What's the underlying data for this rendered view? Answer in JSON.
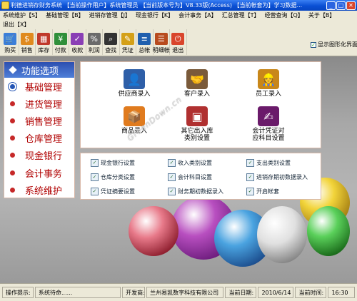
{
  "window": {
    "title": "利德进销存财务系统  【当前操作用户】系统管理员  【当前版本号为】V8.33版(Access)  【当前帐套为】学习数据..."
  },
  "menu": {
    "row1": [
      "系统维护【S】",
      "基础管理【B】",
      "进销存管理【J】",
      "现金银行【K】",
      "会计事务【A】",
      "汇总管理【T】",
      "经营查询【Q】",
      "关于【B】"
    ],
    "row2": [
      "退出【X】"
    ]
  },
  "toolbar": {
    "buttons": [
      {
        "label": "购买",
        "icon": "cart-icon",
        "color": "#3c7fd8"
      },
      {
        "label": "销售",
        "icon": "sale-icon",
        "color": "#e08a1e"
      },
      {
        "label": "库存",
        "icon": "warehouse-icon",
        "color": "#c0392b"
      },
      {
        "label": "付款",
        "icon": "payment-icon",
        "color": "#2f8f3a"
      },
      {
        "label": "收款",
        "icon": "receive-icon",
        "color": "#8a3fb5"
      },
      {
        "label": "利润",
        "icon": "profit-icon",
        "color": "#6b6b6b"
      },
      {
        "label": "查找",
        "icon": "binoculars-icon",
        "color": "#333333"
      },
      {
        "label": "凭证",
        "icon": "voucher-icon",
        "color": "#d4a017"
      },
      {
        "label": "总帐",
        "icon": "ledger-icon",
        "color": "#1f5fae"
      },
      {
        "label": "明细帐",
        "icon": "detail-ledger-icon",
        "color": "#b84b1e"
      },
      {
        "label": "退出",
        "icon": "exit-icon",
        "color": "#d9452c"
      }
    ],
    "show_graphic_label": "显示图形化界面",
    "show_graphic_checked": true
  },
  "sidebar": {
    "header": "功能选项",
    "items": [
      "基础管理",
      "进货管理",
      "销售管理",
      "仓库管理",
      "现金银行",
      "会计事务",
      "系统维护"
    ]
  },
  "panel": {
    "items": [
      {
        "label": "供应商录入",
        "icon": "supplier-person-icon",
        "color": "#2e5fa8"
      },
      {
        "label": "客户录入",
        "icon": "handshake-icon",
        "color": "#7a5a3a"
      },
      {
        "label": "员工录入",
        "icon": "employee-icon",
        "color": "#c8871a"
      },
      {
        "label": "商品录入",
        "icon": "goods-boxes-icon",
        "color": "#e07b1e"
      },
      {
        "label": "其它出入库\n类别设置",
        "icon": "stock-category-icon",
        "color": "#b03030"
      },
      {
        "label": "会计凭证对\n应科目设置",
        "icon": "voucher-pen-icon",
        "color": "#6a1a6a"
      }
    ],
    "links": [
      {
        "label": "现金银行设置"
      },
      {
        "label": "收入类别设置"
      },
      {
        "label": "支出类别设置"
      },
      {
        "label": "仓库分类设置"
      },
      {
        "label": "会计科目设置"
      },
      {
        "label": "进销存期初数据录入"
      },
      {
        "label": "凭证摘要设置"
      },
      {
        "label": "财务期初数据录入"
      },
      {
        "label": "开启帐套"
      }
    ]
  },
  "watermark": "GreenDown.cn",
  "status": {
    "op_label": "操作提示:",
    "op_value": "系统待命......",
    "dev_label": "开发商:",
    "dev_value": "兰州易凯数字科技有限公司",
    "date_label": "当前日期:",
    "date_value": "2010/6/14",
    "time_label": "当前时间:",
    "time_value": "16:30"
  }
}
